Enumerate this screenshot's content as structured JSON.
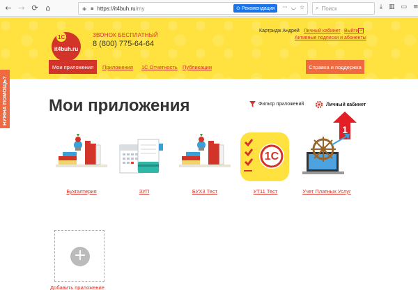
{
  "browser": {
    "url_host": "https://it4buh.ru",
    "url_path": "/my",
    "reco_label": "Рекомендация",
    "search_placeholder": "Поиск"
  },
  "header": {
    "logo_text": "it4buh.ru",
    "logo_badge": "1С",
    "phone_label": "ЗВОНОК БЕСПЛАТНЫЙ",
    "phone_number": "8 (800) 775-64-64",
    "user_name": "Картридж Андрей",
    "cabinet_link": "Личный кабинет",
    "exit_link": "Выйти",
    "subs_link": "Активные подписки и абоненты",
    "nav": {
      "my_apps": "Мои приложения",
      "apps": "Приложения",
      "reports": "1С Отчетность",
      "pubs": "Публикации",
      "help": "Справка и поддержка"
    }
  },
  "side_tab": "НУЖНА ПОМОЩЬ?",
  "main": {
    "title": "Мои приложения",
    "filter_label": "Фильтр приложений",
    "cabinet_label": "Личный кабинет",
    "arrow_number": "1",
    "apps": [
      {
        "label": "Бухгалтерия"
      },
      {
        "label": "ЗУП"
      },
      {
        "label": "БУХ3 Тест"
      },
      {
        "label": "УТ11 Тест"
      },
      {
        "label": "Учет Платных Услуг"
      }
    ],
    "add_label": "Добавить приложение"
  },
  "colors": {
    "brand_yellow": "#ffe23f",
    "brand_red": "#d3342a",
    "accent_orange": "#ef6a40"
  }
}
